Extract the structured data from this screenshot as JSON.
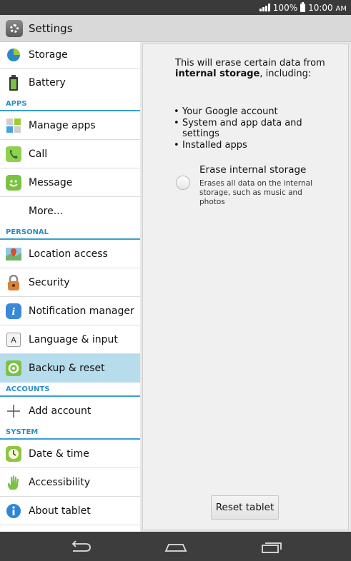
{
  "status_bar": {
    "battery_text": "100%",
    "time": "10:00",
    "ampm": "AM"
  },
  "action_bar": {
    "title": "Settings"
  },
  "sidebar": {
    "items_top": [
      {
        "label": "Storage",
        "icon": "storage-pie-icon"
      },
      {
        "label": "Battery",
        "icon": "battery-icon"
      }
    ],
    "section_apps": "APPS",
    "items_apps": [
      {
        "label": "Manage apps",
        "icon": "manage-apps-icon"
      },
      {
        "label": "Call",
        "icon": "call-icon"
      },
      {
        "label": "Message",
        "icon": "message-icon"
      },
      {
        "label": "More...",
        "icon": ""
      }
    ],
    "section_personal": "PERSONAL",
    "items_personal": [
      {
        "label": "Location access",
        "icon": "location-icon"
      },
      {
        "label": "Security",
        "icon": "lock-icon"
      },
      {
        "label": "Notification manager",
        "icon": "info-italic-icon"
      },
      {
        "label": "Language & input",
        "icon": "keyboard-a-icon"
      },
      {
        "label": "Backup & reset",
        "icon": "backup-reset-icon"
      }
    ],
    "section_accounts": "ACCOUNTS",
    "items_accounts": [
      {
        "label": "Add account",
        "icon": "plus-icon"
      }
    ],
    "section_system": "SYSTEM",
    "items_system": [
      {
        "label": "Date & time",
        "icon": "clock-icon"
      },
      {
        "label": "Accessibility",
        "icon": "hand-icon"
      },
      {
        "label": "About tablet",
        "icon": "info-icon"
      }
    ]
  },
  "content": {
    "intro_prefix": "This will erase certain data from ",
    "intro_bold": "internal storage",
    "intro_suffix": ", including:",
    "bullets": [
      "Your Google account",
      "System and app data and settings",
      "Installed apps"
    ],
    "erase_title": "Erase internal storage",
    "erase_subtitle": "Erases all data on the internal storage, such as music and photos",
    "reset_button": "Reset tablet"
  },
  "colors": {
    "accent": "#3aa0d0",
    "selected": "#b7dcec"
  }
}
